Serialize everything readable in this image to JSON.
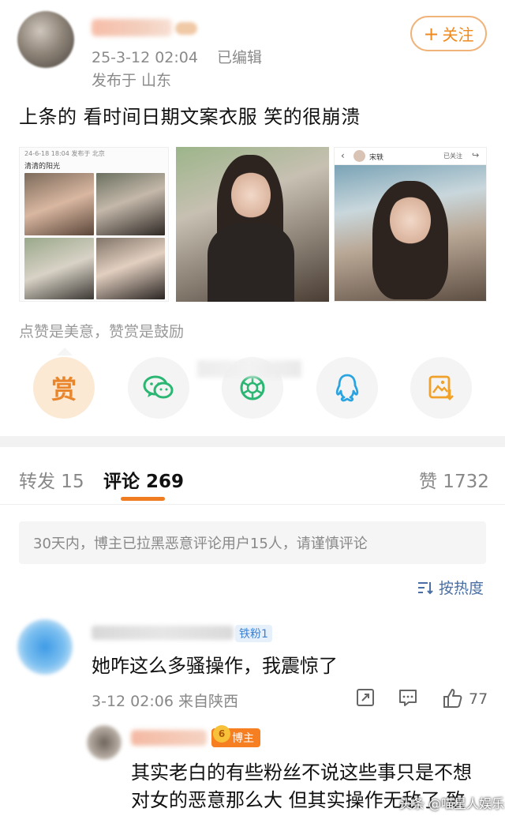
{
  "header": {
    "timestamp": "25-3-12 02:04",
    "edited": "已编辑",
    "location": "发布于 山东",
    "follow_label": "关注",
    "follow_plus": "+"
  },
  "post": {
    "text": "上条的 看时间日期文案衣服 笑的很崩溃"
  },
  "images": {
    "pic1": {
      "header_date": "24-6-18 18:04 发布于 北京",
      "caption": "清清的阳光"
    },
    "pic3": {
      "name": "宋轶",
      "follow": "已关注"
    }
  },
  "reward": {
    "text": "点赞是美意，赞赏是鼓励",
    "reward_label": "赏"
  },
  "share_icons": [
    "reward-icon",
    "wechat-icon",
    "moments-icon",
    "qq-icon",
    "save-image-icon"
  ],
  "tabs": {
    "repost": "转发 15",
    "comments": "评论 269",
    "likes": "赞 1732"
  },
  "notice": "30天内，博主已拉黑恶意评论用户15人，请谨慎评论",
  "sort": {
    "label": "按热度",
    "icon": "sort-icon"
  },
  "comment": {
    "badge": "铁粉1",
    "text": "她咋这么多骚操作，我震惊了",
    "meta": "3-12 02:06 来自陕西",
    "like_count": "77"
  },
  "reply": {
    "badge": "博主",
    "badge_num": "6",
    "line1": "其实老白的有些粉丝不说这些事只是不想",
    "line2": "对女的恶意那么大 但其实操作无敌了 致"
  },
  "watermark": "头条 @喵星人娱乐",
  "colors": {
    "accent": "#f07c22",
    "link": "#4a6fa5",
    "wechat": "#2bb673",
    "qq": "#2aa4e0",
    "save": "#f0a12a"
  }
}
